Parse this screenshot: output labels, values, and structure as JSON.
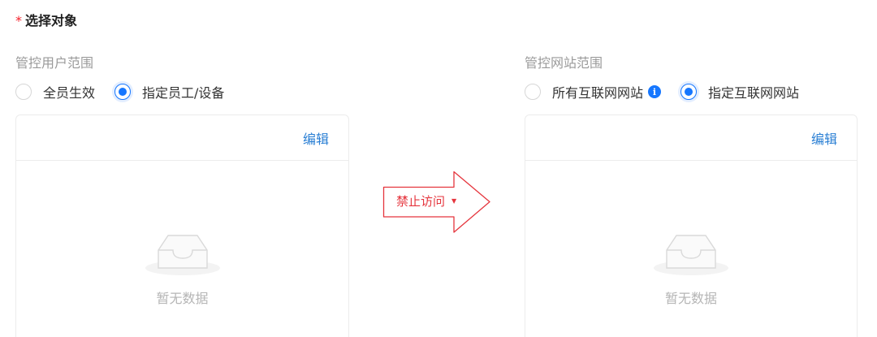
{
  "section": {
    "required_mark": "*",
    "title": "选择对象"
  },
  "left": {
    "scope_label": "管控用户范围",
    "options": [
      {
        "label": "全员生效",
        "checked": false
      },
      {
        "label": "指定员工/设备",
        "checked": true
      }
    ],
    "edit_label": "编辑",
    "empty_text": "暂无数据"
  },
  "action": {
    "label": "禁止访问",
    "caret": "▼"
  },
  "right": {
    "scope_label": "管控网站范围",
    "options": [
      {
        "label": "所有互联网网站",
        "checked": false,
        "info_icon": "i"
      },
      {
        "label": "指定互联网网站",
        "checked": true
      }
    ],
    "edit_label": "编辑",
    "empty_text": "暂无数据"
  },
  "colors": {
    "accent": "#1677ff",
    "link": "#2a7fd4",
    "danger": "#e5353d",
    "required": "#f5222d"
  }
}
